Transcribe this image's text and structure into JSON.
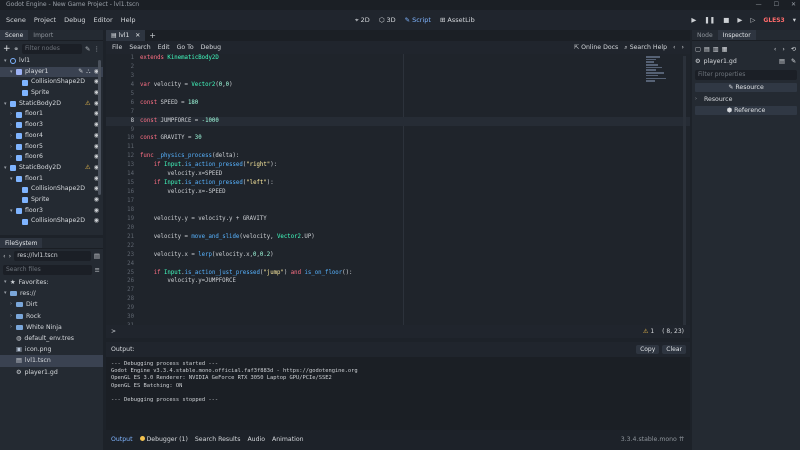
{
  "window": {
    "title": "Godot Engine - New Game Project - lvl1.tscn"
  },
  "menubar": {
    "items": [
      "Scene",
      "Project",
      "Debug",
      "Editor",
      "Help"
    ],
    "modes": [
      {
        "label": "2D",
        "icon": "2d-icon"
      },
      {
        "label": "3D",
        "icon": "3d-icon"
      },
      {
        "label": "Script",
        "icon": "script-icon",
        "active": true
      },
      {
        "label": "AssetLib",
        "icon": "assetlib-icon"
      }
    ],
    "renderer": "GLES3"
  },
  "scene_dock": {
    "tabs": [
      "Scene",
      "Import"
    ],
    "filter_placeholder": "Filter nodes",
    "nodes": [
      {
        "label": "lvl1",
        "depth": 0
      },
      {
        "label": "player1",
        "depth": 1,
        "selected": true
      },
      {
        "label": "CollisionShape2D",
        "depth": 2
      },
      {
        "label": "Sprite",
        "depth": 2
      },
      {
        "label": "StaticBody2D",
        "depth": 1,
        "warning": true
      },
      {
        "label": "floor1",
        "depth": 2
      },
      {
        "label": "floor3",
        "depth": 2
      },
      {
        "label": "floor4",
        "depth": 2
      },
      {
        "label": "floor5",
        "depth": 2
      },
      {
        "label": "floor6",
        "depth": 2
      },
      {
        "label": "StaticBody2D",
        "depth": 1,
        "warning": true
      },
      {
        "label": "floor1",
        "depth": 2
      },
      {
        "label": "CollisionShape2D",
        "depth": 3
      },
      {
        "label": "Sprite",
        "depth": 3
      },
      {
        "label": "floor3",
        "depth": 2
      },
      {
        "label": "CollisionShape2D",
        "depth": 3
      }
    ]
  },
  "filesystem_dock": {
    "tab": "FileSystem",
    "path": "res://lvl1.tscn",
    "search_placeholder": "Search files",
    "items": [
      {
        "label": "Favorites:",
        "type": "favorites",
        "depth": 0
      },
      {
        "label": "res://",
        "type": "folder",
        "depth": 0
      },
      {
        "label": "Dirt",
        "type": "folder",
        "depth": 1
      },
      {
        "label": "Rock",
        "type": "folder",
        "depth": 1
      },
      {
        "label": "White Ninja",
        "type": "folder",
        "depth": 1
      },
      {
        "label": "default_env.tres",
        "type": "file",
        "depth": 1
      },
      {
        "label": "icon.png",
        "type": "file",
        "depth": 1
      },
      {
        "label": "lvl1.tscn",
        "type": "file",
        "depth": 1,
        "selected": true
      },
      {
        "label": "player1.gd",
        "type": "file",
        "depth": 1
      }
    ]
  },
  "script_editor": {
    "open_tab": "lvl1",
    "menu": [
      "File",
      "Search",
      "Edit",
      "Go To",
      "Debug"
    ],
    "online_docs": "Online Docs",
    "search_help": "Search Help",
    "current_line": 8,
    "lines": [
      {
        "n": "1",
        "text": "extends KinematicBody2D"
      },
      {
        "n": "2",
        "text": ""
      },
      {
        "n": "3",
        "text": ""
      },
      {
        "n": "4",
        "text": "var velocity = Vector2(0,0)"
      },
      {
        "n": "5",
        "text": ""
      },
      {
        "n": "6",
        "text": "const SPEED = 180"
      },
      {
        "n": "7",
        "text": ""
      },
      {
        "n": "8",
        "text": "const JUMPFORCE = -1000"
      },
      {
        "n": "9",
        "text": ""
      },
      {
        "n": "10",
        "text": "const GRAVITY = 30"
      },
      {
        "n": "11",
        "text": ""
      },
      {
        "n": "12",
        "text": "func _physics_process(delta):"
      },
      {
        "n": "13",
        "text": "    if Input.is_action_pressed(\"right\"):"
      },
      {
        "n": "14",
        "text": "        velocity.x=SPEED"
      },
      {
        "n": "15",
        "text": "    if Input.is_action_pressed(\"left\"):"
      },
      {
        "n": "16",
        "text": "        velocity.x=-SPEED"
      },
      {
        "n": "17",
        "text": ""
      },
      {
        "n": "18",
        "text": ""
      },
      {
        "n": "19",
        "text": "    velocity.y = velocity.y + GRAVITY"
      },
      {
        "n": "20",
        "text": ""
      },
      {
        "n": "21",
        "text": "    velocity = move_and_slide(velocity, Vector2.UP)"
      },
      {
        "n": "22",
        "text": ""
      },
      {
        "n": "23",
        "text": "    velocity.x = lerp(velocity.x,0,0.2)"
      },
      {
        "n": "24",
        "text": ""
      },
      {
        "n": "25",
        "text": "    if Input.is_action_just_pressed(\"jump\") and is_on_floor():"
      },
      {
        "n": "26",
        "text": "        velocity.y=JUMPFORCE"
      },
      {
        "n": "27",
        "text": ""
      },
      {
        "n": "28",
        "text": ""
      },
      {
        "n": "29",
        "text": ""
      },
      {
        "n": "30",
        "text": ""
      },
      {
        "n": "31",
        "text": ""
      }
    ],
    "status_prompt": ">",
    "warnings_count": "1",
    "cursor_pos": "( 8, 23)"
  },
  "output": {
    "title": "Output:",
    "copy": "Copy",
    "clear": "Clear",
    "lines": [
      "--- Debugging process started ---",
      "Godot Engine v3.3.4.stable.mono.official.faf3f883d - https://godotengine.org",
      "OpenGL ES 3.0 Renderer: NVIDIA GeForce RTX 3050 Laptop GPU/PCIe/SSE2",
      "OpenGL ES Batching: ON",
      "",
      "--- Debugging process stopped ---"
    ]
  },
  "bottom_tabs": {
    "items": [
      "Output",
      "Debugger (1)",
      "Search Results",
      "Audio",
      "Animation"
    ],
    "version": "3.3.4.stable.mono"
  },
  "inspector": {
    "tabs": [
      "Node",
      "Inspector"
    ],
    "resource": "player1.gd",
    "filter_placeholder": "Filter properties",
    "sections": [
      "Resource",
      "Resource",
      "Reference"
    ]
  }
}
